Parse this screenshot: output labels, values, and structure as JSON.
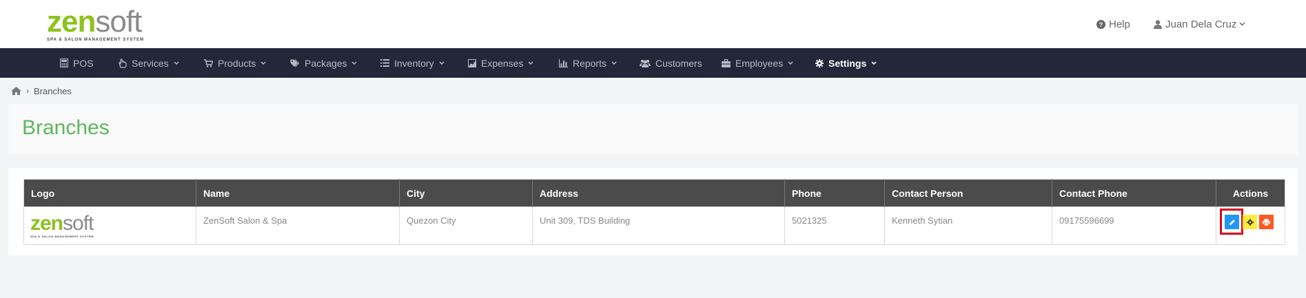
{
  "header": {
    "logo": {
      "word_zen": "zen",
      "word_soft": "soft",
      "tagline": "SPA & SALON MANAGEMENT SYSTEM"
    },
    "help_label": "Help",
    "user_name": "Juan Dela Cruz"
  },
  "nav": {
    "items": [
      {
        "label": "POS",
        "icon": "calculator-icon",
        "dropdown": false
      },
      {
        "label": "Services",
        "icon": "hand-icon",
        "dropdown": true
      },
      {
        "label": "Products",
        "icon": "cart-icon",
        "dropdown": true
      },
      {
        "label": "Packages",
        "icon": "tags-icon",
        "dropdown": true
      },
      {
        "label": "Inventory",
        "icon": "list-icon",
        "dropdown": true
      },
      {
        "label": "Expenses",
        "icon": "chart-area-icon",
        "dropdown": true
      },
      {
        "label": "Reports",
        "icon": "bar-chart-icon",
        "dropdown": true
      },
      {
        "label": "Customers",
        "icon": "users-icon",
        "dropdown": false
      },
      {
        "label": "Employees",
        "icon": "briefcase-icon",
        "dropdown": true
      },
      {
        "label": "Settings",
        "icon": "gear-icon",
        "dropdown": true,
        "active": true
      }
    ]
  },
  "breadcrumb": {
    "current": "Branches"
  },
  "page": {
    "title": "Branches"
  },
  "table": {
    "columns": [
      "Logo",
      "Name",
      "City",
      "Address",
      "Phone",
      "Contact Person",
      "Contact Phone",
      "Actions"
    ],
    "rows": [
      {
        "logo": {
          "word_zen": "zen",
          "word_soft": "soft",
          "tagline": "SPA & SALON MANAGEMENT SYSTEM"
        },
        "name": "ZenSoft Salon & Spa",
        "city": "Quezon City",
        "address": "Unit 309, TDS Building",
        "phone": "5021325",
        "contact_person": "Kenneth Sytian",
        "contact_phone": "09175596699"
      }
    ]
  },
  "colors": {
    "nav_bg": "#24273a",
    "title_green": "#5cb85c",
    "logo_green": "#8dc21f",
    "edit_blue": "#2196f3",
    "settings_yellow": "#ffeb3b",
    "print_orange": "#ff5722",
    "highlight_red": "#d9001b"
  }
}
